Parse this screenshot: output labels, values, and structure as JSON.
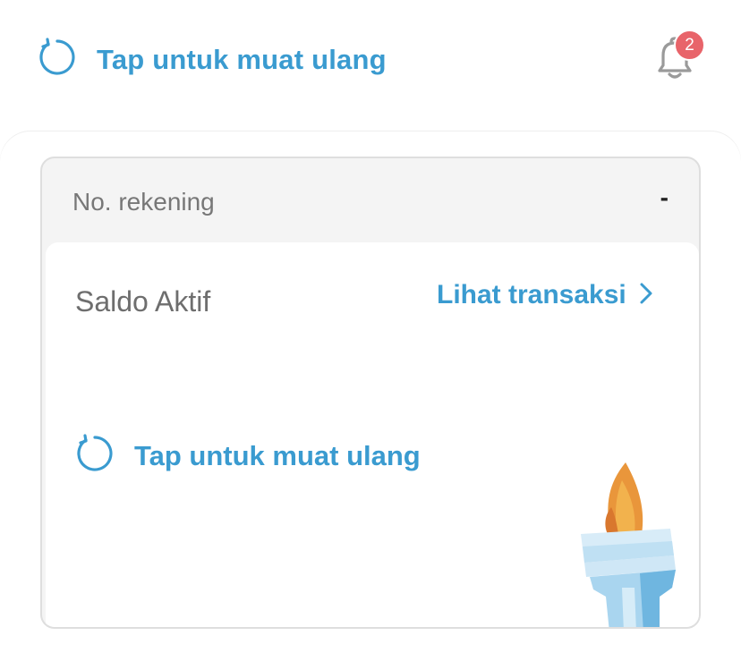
{
  "header": {
    "reload_label": "Tap untuk muat ulang",
    "notification_count": "2"
  },
  "card": {
    "account_label": "No. rekening",
    "account_value": "-",
    "balance_label": "Saldo Aktif",
    "transactions_link": "Lihat transaksi",
    "reload_label": "Tap untuk muat ulang"
  },
  "colors": {
    "accent": "#3a9bd0",
    "badge": "#e8646a"
  },
  "icons": [
    "reload-icon",
    "bell-icon",
    "chevron-right-icon",
    "torch-illustration"
  ]
}
